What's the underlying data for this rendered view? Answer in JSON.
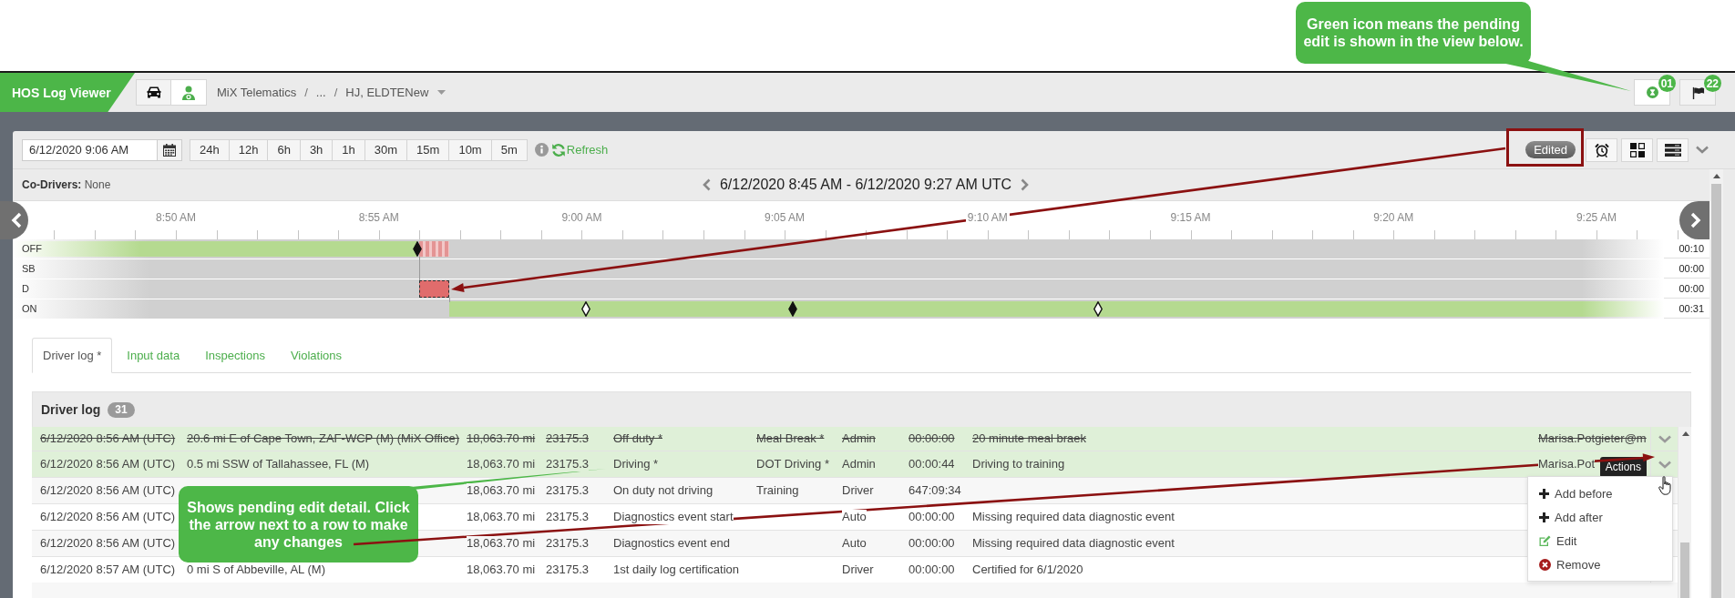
{
  "annotations": {
    "callouts": [
      {
        "text": "Green icon means the pending edit is shown in the view below."
      },
      {
        "text": "Shows pending edit detail. Click the arrow next to a row to make any changes"
      }
    ]
  },
  "header": {
    "app_title": "HOS Log Viewer",
    "view_buttons": [
      {
        "kind": "vehicle",
        "selected": false
      },
      {
        "kind": "driver",
        "selected": true
      }
    ],
    "breadcrumb": [
      {
        "kind": "crumb",
        "text": "MiX Telematics"
      },
      {
        "kind": "separator",
        "text": "/"
      },
      {
        "kind": "crumb",
        "text": "..."
      },
      {
        "kind": "separator",
        "text": "/"
      },
      {
        "kind": "crumb",
        "text": "HJ, ELDTENew"
      }
    ],
    "status_buttons": [
      {
        "kind": "pending-edits",
        "badge": "01",
        "active": true
      },
      {
        "kind": "flags",
        "badge": "22",
        "active": false
      }
    ]
  },
  "toolbar": {
    "date_field": {
      "value": "6/12/2020 9:06 AM"
    },
    "ranges": [
      {
        "label": "24h",
        "selected": false
      },
      {
        "label": "12h",
        "selected": false
      },
      {
        "label": "6h",
        "selected": false
      },
      {
        "label": "3h",
        "selected": false
      },
      {
        "label": "1h",
        "selected": false
      },
      {
        "label": "30m",
        "selected": false
      },
      {
        "label": "15m",
        "selected": false
      },
      {
        "label": "10m",
        "selected": false
      },
      {
        "label": "5m",
        "selected": false
      }
    ],
    "refresh": {
      "label": "Refresh"
    },
    "edited_badge": "Edited",
    "tool_buttons": [
      {
        "kind": "alarm"
      },
      {
        "kind": "layout"
      },
      {
        "kind": "list"
      }
    ]
  },
  "range_header": {
    "co_drivers": "**Co-Drivers:** None",
    "title": "6/12/2020 8:45 AM - 6/12/2020 9:27 AM UTC"
  },
  "timeline": {
    "axis_labels": [
      "8:50 AM",
      "8:55 AM",
      "9:00 AM",
      "9:05 AM",
      "9:10 AM",
      "9:15 AM",
      "9:20 AM",
      "9:25 AM"
    ],
    "rows": [
      {
        "label": "OFF",
        "total": "00:10"
      },
      {
        "label": "SB",
        "total": "00:00"
      },
      {
        "label": "D",
        "total": "00:00"
      },
      {
        "label": "ON",
        "total": "00:31"
      }
    ]
  },
  "tabs": [
    {
      "label": "Driver log *",
      "selected": true
    },
    {
      "label": "Input data",
      "selected": false
    },
    {
      "label": "Inspections",
      "selected": false
    },
    {
      "label": "Violations",
      "selected": false
    }
  ],
  "driver_log": {
    "title": "Driver log",
    "count": "31",
    "rows": [
      {
        "kind": "removed",
        "column_1": "6/12/2020 8:56 AM (UTC)",
        "column_2": "20.6 mi E of Cape Town, ZAF-WCP (M) (MiX Office)",
        "column_3": "18,063.70 mi",
        "column_4": "23175.3",
        "column_5": "Off duty *",
        "column_6": "Meal Break *",
        "column_7": "Admin",
        "column_8": "00:00:00",
        "column_9": "20 minute meal braek",
        "column_10": "Marisa.Potgieter@m",
        "menu_open": false
      },
      {
        "kind": "added",
        "column_1": "6/12/2020 8:56 AM (UTC)",
        "column_2": "0.5 mi SSW of Tallahassee, FL (M)",
        "column_3": "18,063.70 mi",
        "column_4": "23175.3",
        "column_5": "Driving *",
        "column_6": "DOT Driving *",
        "column_7": "Admin",
        "column_8": "00:00:44",
        "column_9": "Driving to training",
        "column_10": "Marisa.Pot",
        "menu_open": true
      },
      {
        "kind": "saved",
        "column_1": "6/12/2020 8:56 AM (UTC)",
        "column_3": "18,063.70 mi",
        "column_4": "23175.3",
        "column_5": "On duty not driving",
        "column_6": "Training",
        "column_7": "Driver",
        "column_8": "647:09:34",
        "menu_open": false
      },
      {
        "kind": "saved",
        "column_1": "6/12/2020 8:56 AM (UTC)",
        "column_3": "18,063.70 mi",
        "column_4": "23175.3",
        "column_5": "Diagnostics event start",
        "column_7": "Auto",
        "column_8": "00:00:00",
        "column_9": "Missing required data diagnostic event",
        "menu_open": false
      },
      {
        "kind": "saved",
        "column_1": "6/12/2020 8:56 AM (UTC)",
        "column_3": "18,063.70 mi",
        "column_4": "23175.3",
        "column_5": "Diagnostics event end",
        "column_7": "Auto",
        "column_8": "00:00:00",
        "column_9": "Missing required data diagnostic event",
        "menu_open": false
      },
      {
        "kind": "saved",
        "column_1": "6/12/2020 8:57 AM (UTC)",
        "column_2": "0 mi S of Abbeville, AL (M)",
        "column_3": "18,063.70 mi",
        "column_4": "23175.3",
        "column_5": "1st daily log certification",
        "column_7": "Driver",
        "column_8": "00:00:00",
        "column_9": "Certified for 6/1/2020",
        "menu_open": false
      }
    ]
  },
  "actions_menu": {
    "tooltip": "Actions",
    "items": [
      {
        "kind": "add",
        "label": "Add before"
      },
      {
        "kind": "add",
        "label": "Add after"
      },
      {
        "kind": "edit",
        "label": "Edit"
      },
      {
        "kind": "remove",
        "label": "Remove"
      }
    ]
  }
}
